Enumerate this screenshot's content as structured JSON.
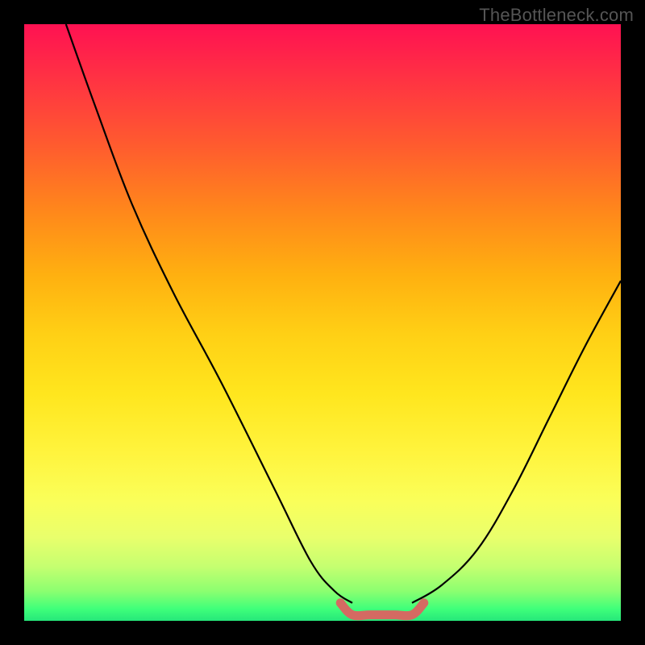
{
  "watermark": "TheBottleneck.com",
  "chart_data": {
    "type": "line",
    "title": "",
    "xlabel": "",
    "ylabel": "",
    "xlim": [
      0,
      100
    ],
    "ylim": [
      0,
      100
    ],
    "series": [
      {
        "name": "left-curve",
        "x": [
          7,
          12,
          18,
          25,
          33,
          42,
          48,
          52,
          55
        ],
        "y": [
          100,
          86,
          70,
          55,
          40,
          22,
          10,
          5,
          3
        ]
      },
      {
        "name": "right-curve",
        "x": [
          65,
          70,
          76,
          82,
          88,
          94,
          100
        ],
        "y": [
          3,
          6,
          12,
          22,
          34,
          46,
          57
        ]
      },
      {
        "name": "bottom-bracket",
        "x": [
          53,
          55,
          58,
          62,
          65,
          67
        ],
        "y": [
          3,
          1,
          1,
          1,
          1,
          3
        ]
      }
    ],
    "colors": {
      "curve": "#000000",
      "bracket": "#d46a62"
    }
  }
}
